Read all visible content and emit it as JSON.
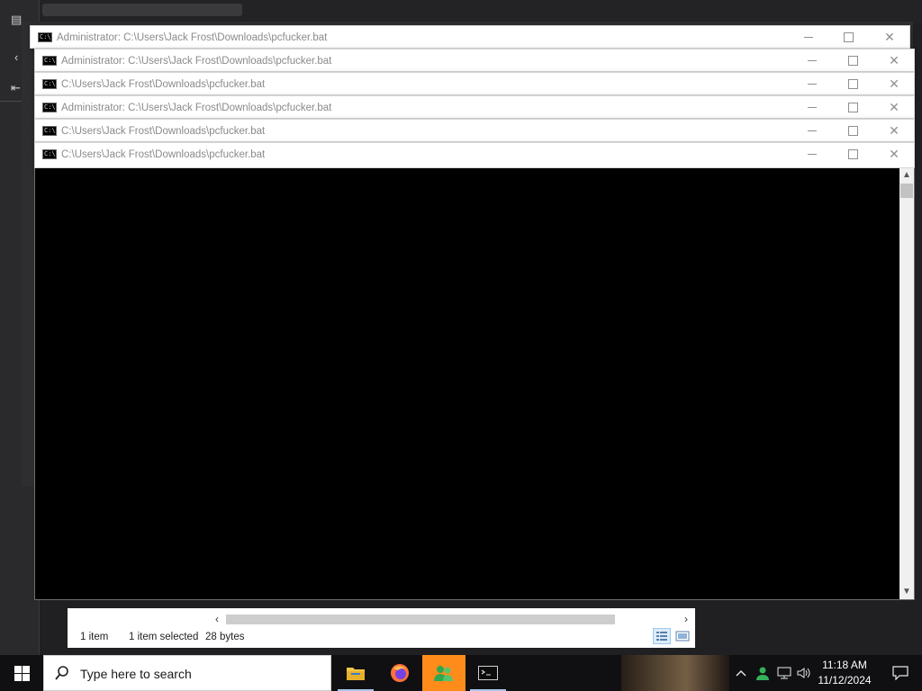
{
  "windows": [
    {
      "title": "Administrator: C:\\Users\\Jack Frost\\Downloads\\pcfucker.bat",
      "icon_label": "C:\\."
    },
    {
      "title": "Administrator: C:\\Users\\Jack Frost\\Downloads\\pcfucker.bat",
      "icon_label": "C:\\."
    },
    {
      "title": "C:\\Users\\Jack Frost\\Downloads\\pcfucker.bat",
      "icon_label": "C:\\."
    },
    {
      "title": "Administrator: C:\\Users\\Jack Frost\\Downloads\\pcfucker.bat",
      "icon_label": "C:\\."
    },
    {
      "title": "C:\\Users\\Jack Frost\\Downloads\\pcfucker.bat",
      "icon_label": "C:\\."
    },
    {
      "title": "C:\\Users\\Jack Frost\\Downloads\\pcfucker.bat",
      "icon_label": "C:\\."
    }
  ],
  "explorer": {
    "item_count": "1 item",
    "selection": "1 item selected",
    "size": "28 bytes"
  },
  "taskbar": {
    "search_placeholder": "Type here to search",
    "apps": [
      "file-explorer",
      "firefox",
      "user-app",
      "command-prompt"
    ],
    "active_app": "user-app",
    "time": "11:18 AM",
    "date": "11/12/2024"
  },
  "colors": {
    "console_bg": "#000000",
    "taskbar_bg": "#101012",
    "active_app_bg": "#ff8c1a",
    "title_text": "#8a8a8a"
  }
}
